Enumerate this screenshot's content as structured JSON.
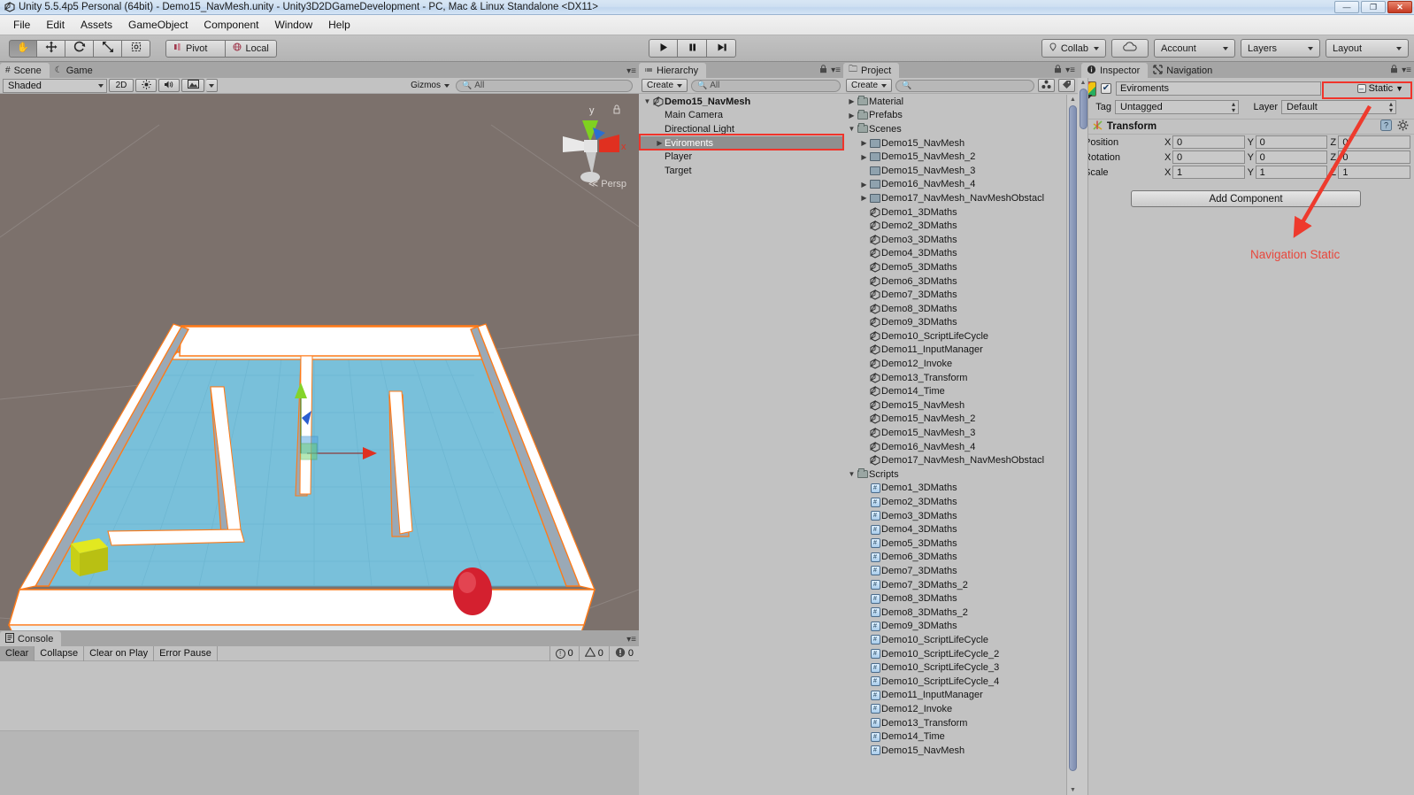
{
  "window": {
    "title": "Unity 5.5.4p5 Personal (64bit) - Demo15_NavMesh.unity - Unity3D2DGameDevelopment - PC, Mac & Linux Standalone <DX11>",
    "app_icon": "unity-icon",
    "controls": {
      "minimize": "—",
      "maximize": "❐",
      "close": "✕"
    }
  },
  "menu": {
    "items": [
      "File",
      "Edit",
      "Assets",
      "GameObject",
      "Component",
      "Window",
      "Help"
    ]
  },
  "toolbar": {
    "transform_tools": [
      {
        "name": "hand-tool",
        "glyph": "✋",
        "active": true
      },
      {
        "name": "move-tool",
        "glyph": "✥",
        "active": false
      },
      {
        "name": "rotate-tool",
        "glyph": "⟳",
        "active": false
      },
      {
        "name": "scale-tool",
        "glyph": "⤢",
        "active": false
      },
      {
        "name": "rect-tool",
        "glyph": "⬚",
        "active": false
      }
    ],
    "pivot_label": "Pivot",
    "local_label": "Local",
    "play_label": "▶",
    "pause_label": "❙❙",
    "step_label": "▶❙",
    "collab_label": "Collab",
    "cloud_label": "cloud-icon",
    "account_label": "Account",
    "layers_label": "Layers",
    "layout_label": "Layout"
  },
  "scene_panel": {
    "tabs": [
      {
        "label": "Scene",
        "icon": "grid-icon",
        "active": true
      },
      {
        "label": "Game",
        "icon": "gamepad-icon",
        "active": false
      }
    ],
    "shading_mode": "Shaded",
    "two_d_label": "2D",
    "light_icon": "sun-icon",
    "audio_icon": "speaker-icon",
    "fx_icon": "image-icon",
    "gizmos_label": "Gizmos",
    "search_placeholder": "All",
    "search_value": "",
    "gizmo": {
      "y_label": "y",
      "x_label": "x",
      "projection": "Persp",
      "colors": {
        "x": "#e03020",
        "y": "#7fd120",
        "z": "#2a6fd0"
      }
    },
    "selection_outline_color": "#ff7a18"
  },
  "hierarchy": {
    "tab_label": "Hierarchy",
    "tab_icon": "hierarchy-icon",
    "create_label": "Create",
    "search_placeholder": "All",
    "search_value": "",
    "items": [
      {
        "label": "Demo15_NavMesh",
        "depth": 0,
        "icon": "unity-scene-icon",
        "expanded": true,
        "bold": true,
        "selected": false
      },
      {
        "label": "Main Camera",
        "depth": 1,
        "icon": "none",
        "expanded": null,
        "bold": false,
        "selected": false
      },
      {
        "label": "Directional Light",
        "depth": 1,
        "icon": "none",
        "expanded": null,
        "bold": false,
        "selected": false
      },
      {
        "label": "Eviroments",
        "depth": 1,
        "icon": "none",
        "expanded": false,
        "bold": false,
        "selected": true
      },
      {
        "label": "Player",
        "depth": 1,
        "icon": "none",
        "expanded": null,
        "bold": false,
        "selected": false
      },
      {
        "label": "Target",
        "depth": 1,
        "icon": "none",
        "expanded": null,
        "bold": false,
        "selected": false
      }
    ]
  },
  "project": {
    "tab_label": "Project",
    "tab_icon": "folder-icon",
    "create_label": "Create",
    "search_placeholder": "",
    "search_value": "",
    "items": [
      {
        "label": "Material",
        "depth": 0,
        "icon": "folder",
        "expanded": false
      },
      {
        "label": "Prefabs",
        "depth": 0,
        "icon": "folder",
        "expanded": false
      },
      {
        "label": "Scenes",
        "depth": 0,
        "icon": "folder",
        "expanded": true
      },
      {
        "label": "Demo15_NavMesh",
        "depth": 1,
        "icon": "scene",
        "expanded": false
      },
      {
        "label": "Demo15_NavMesh_2",
        "depth": 1,
        "icon": "scene",
        "expanded": false
      },
      {
        "label": "Demo15_NavMesh_3",
        "depth": 1,
        "icon": "scene",
        "expanded": null
      },
      {
        "label": "Demo16_NavMesh_4",
        "depth": 1,
        "icon": "scene",
        "expanded": false
      },
      {
        "label": "Demo17_NavMesh_NavMeshObstacl",
        "depth": 1,
        "icon": "scene",
        "expanded": false
      },
      {
        "label": "Demo1_3DMaths",
        "depth": 1,
        "icon": "unity",
        "expanded": null
      },
      {
        "label": "Demo2_3DMaths",
        "depth": 1,
        "icon": "unity",
        "expanded": null
      },
      {
        "label": "Demo3_3DMaths",
        "depth": 1,
        "icon": "unity",
        "expanded": null
      },
      {
        "label": "Demo4_3DMaths",
        "depth": 1,
        "icon": "unity",
        "expanded": null
      },
      {
        "label": "Demo5_3DMaths",
        "depth": 1,
        "icon": "unity",
        "expanded": null
      },
      {
        "label": "Demo6_3DMaths",
        "depth": 1,
        "icon": "unity",
        "expanded": null
      },
      {
        "label": "Demo7_3DMaths",
        "depth": 1,
        "icon": "unity",
        "expanded": null
      },
      {
        "label": "Demo8_3DMaths",
        "depth": 1,
        "icon": "unity",
        "expanded": null
      },
      {
        "label": "Demo9_3DMaths",
        "depth": 1,
        "icon": "unity",
        "expanded": null
      },
      {
        "label": "Demo10_ScriptLifeCycle",
        "depth": 1,
        "icon": "unity",
        "expanded": null
      },
      {
        "label": "Demo11_InputManager",
        "depth": 1,
        "icon": "unity",
        "expanded": null
      },
      {
        "label": "Demo12_Invoke",
        "depth": 1,
        "icon": "unity",
        "expanded": null
      },
      {
        "label": "Demo13_Transform",
        "depth": 1,
        "icon": "unity",
        "expanded": null
      },
      {
        "label": "Demo14_Time",
        "depth": 1,
        "icon": "unity",
        "expanded": null
      },
      {
        "label": "Demo15_NavMesh",
        "depth": 1,
        "icon": "unity",
        "expanded": null
      },
      {
        "label": "Demo15_NavMesh_2",
        "depth": 1,
        "icon": "unity",
        "expanded": null
      },
      {
        "label": "Demo15_NavMesh_3",
        "depth": 1,
        "icon": "unity",
        "expanded": null
      },
      {
        "label": "Demo16_NavMesh_4",
        "depth": 1,
        "icon": "unity",
        "expanded": null
      },
      {
        "label": "Demo17_NavMesh_NavMeshObstacl",
        "depth": 1,
        "icon": "unity",
        "expanded": null
      },
      {
        "label": "Scripts",
        "depth": 0,
        "icon": "folder",
        "expanded": true
      },
      {
        "label": "Demo1_3DMaths",
        "depth": 1,
        "icon": "cs",
        "expanded": null
      },
      {
        "label": "Demo2_3DMaths",
        "depth": 1,
        "icon": "cs",
        "expanded": null
      },
      {
        "label": "Demo3_3DMaths",
        "depth": 1,
        "icon": "cs",
        "expanded": null
      },
      {
        "label": "Demo4_3DMaths",
        "depth": 1,
        "icon": "cs",
        "expanded": null
      },
      {
        "label": "Demo5_3DMaths",
        "depth": 1,
        "icon": "cs",
        "expanded": null
      },
      {
        "label": "Demo6_3DMaths",
        "depth": 1,
        "icon": "cs",
        "expanded": null
      },
      {
        "label": "Demo7_3DMaths",
        "depth": 1,
        "icon": "cs",
        "expanded": null
      },
      {
        "label": "Demo7_3DMaths_2",
        "depth": 1,
        "icon": "cs",
        "expanded": null
      },
      {
        "label": "Demo8_3DMaths",
        "depth": 1,
        "icon": "cs",
        "expanded": null
      },
      {
        "label": "Demo8_3DMaths_2",
        "depth": 1,
        "icon": "cs",
        "expanded": null
      },
      {
        "label": "Demo9_3DMaths",
        "depth": 1,
        "icon": "cs",
        "expanded": null
      },
      {
        "label": "Demo10_ScriptLifeCycle",
        "depth": 1,
        "icon": "cs",
        "expanded": null
      },
      {
        "label": "Demo10_ScriptLifeCycle_2",
        "depth": 1,
        "icon": "cs",
        "expanded": null
      },
      {
        "label": "Demo10_ScriptLifeCycle_3",
        "depth": 1,
        "icon": "cs",
        "expanded": null
      },
      {
        "label": "Demo10_ScriptLifeCycle_4",
        "depth": 1,
        "icon": "cs",
        "expanded": null
      },
      {
        "label": "Demo11_InputManager",
        "depth": 1,
        "icon": "cs",
        "expanded": null
      },
      {
        "label": "Demo12_Invoke",
        "depth": 1,
        "icon": "cs",
        "expanded": null
      },
      {
        "label": "Demo13_Transform",
        "depth": 1,
        "icon": "cs",
        "expanded": null
      },
      {
        "label": "Demo14_Time",
        "depth": 1,
        "icon": "cs",
        "expanded": null
      },
      {
        "label": "Demo15_NavMesh",
        "depth": 1,
        "icon": "cs",
        "expanded": null
      }
    ]
  },
  "inspector": {
    "tabs": [
      {
        "label": "Inspector",
        "icon": "info-icon",
        "active": true
      },
      {
        "label": "Navigation",
        "icon": "navigation-icon",
        "active": false
      }
    ],
    "object_icon": "prefab-cube-icon",
    "object_enabled": true,
    "object_name": "Eviroments",
    "static_label": "Static",
    "tag_label": "Tag",
    "tag_value": "Untagged",
    "layer_label": "Layer",
    "layer_value": "Default",
    "transform": {
      "title": "Transform",
      "rows": [
        {
          "label": "Position",
          "x": "0",
          "y": "0",
          "z": "0"
        },
        {
          "label": "Rotation",
          "x": "0",
          "y": "0",
          "z": "0"
        },
        {
          "label": "Scale",
          "x": "1",
          "y": "1",
          "z": "1"
        }
      ],
      "axes": [
        "X",
        "Y",
        "Z"
      ],
      "help_icon": "help-icon",
      "gear_icon": "gear-icon"
    },
    "add_component_label": "Add Component"
  },
  "console": {
    "tab_label": "Console",
    "tab_icon": "console-icon",
    "buttons": [
      {
        "label": "Clear",
        "pressed": false
      },
      {
        "label": "Collapse",
        "pressed": false
      },
      {
        "label": "Clear on Play",
        "pressed": false
      },
      {
        "label": "Error Pause",
        "pressed": false
      }
    ],
    "counts": [
      {
        "icon": "info-circle-icon",
        "value": "0"
      },
      {
        "icon": "warning-triangle-icon",
        "value": "0"
      },
      {
        "icon": "error-circle-icon",
        "value": "0"
      }
    ]
  },
  "annotations": {
    "hierarchy_highlight": "Eviroments row highlight",
    "static_highlight": "Static dropdown highlight",
    "arrow_label": "Navigation Static",
    "color": "#ee3a2d"
  }
}
